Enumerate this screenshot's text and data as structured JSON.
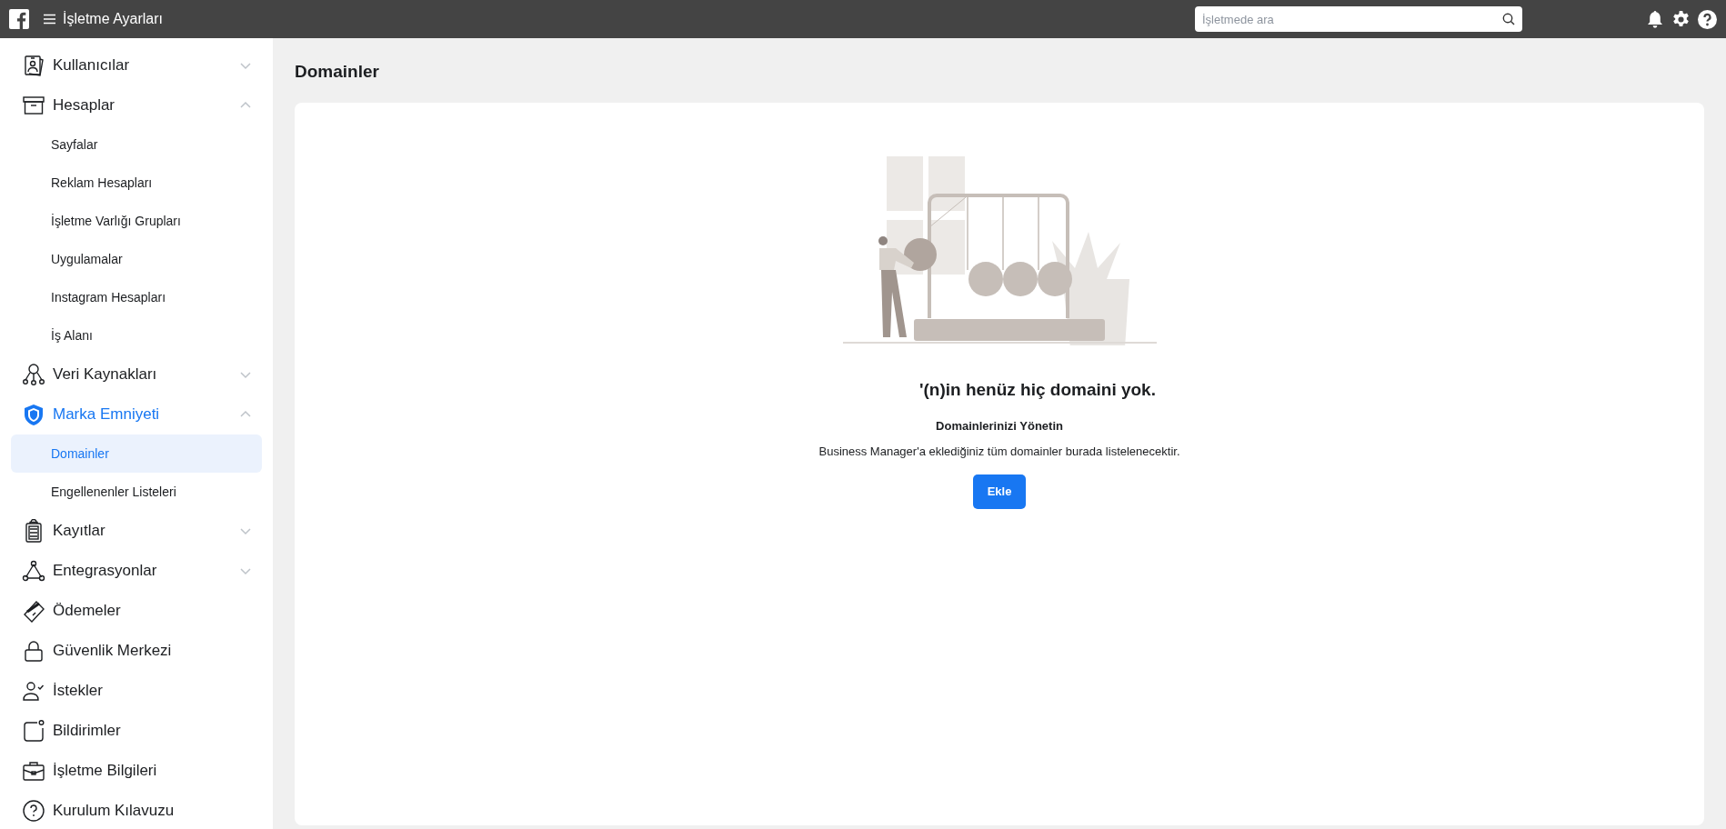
{
  "topbar": {
    "title": "İşletme Ayarları",
    "search": {
      "placeholder": "İşletmede ara"
    }
  },
  "sidebar": {
    "items": [
      {
        "kind": "group",
        "label": "Kullanıcılar",
        "expanded": false
      },
      {
        "kind": "group",
        "label": "Hesaplar",
        "expanded": true,
        "children": [
          {
            "label": "Sayfalar",
            "selected": false
          },
          {
            "label": "Reklam Hesapları",
            "selected": false
          },
          {
            "label": "İşletme Varlığı Grupları",
            "selected": false
          },
          {
            "label": "Uygulamalar",
            "selected": false
          },
          {
            "label": "Instagram Hesapları",
            "selected": false
          },
          {
            "label": "İş Alanı",
            "selected": false
          }
        ]
      },
      {
        "kind": "group",
        "label": "Veri Kaynakları",
        "expanded": false
      },
      {
        "kind": "group",
        "label": "Marka Emniyeti",
        "expanded": true,
        "children": [
          {
            "label": "Domainler",
            "selected": true
          },
          {
            "label": "Engellenenler Listeleri",
            "selected": false
          }
        ]
      },
      {
        "kind": "group",
        "label": "Kayıtlar",
        "expanded": false
      },
      {
        "kind": "group",
        "label": "Entegrasyonlar",
        "expanded": false
      },
      {
        "kind": "link",
        "label": "Ödemeler"
      },
      {
        "kind": "link",
        "label": "Güvenlik Merkezi"
      },
      {
        "kind": "link",
        "label": "İstekler"
      },
      {
        "kind": "link",
        "label": "Bildirimler"
      },
      {
        "kind": "link",
        "label": "İşletme Bilgileri"
      },
      {
        "kind": "link",
        "label": "Kurulum Kılavuzu"
      }
    ]
  },
  "main": {
    "title": "Domainler",
    "empty_state": {
      "heading": "'(n)in henüz hiç domaini yok.",
      "subheading": "Domainlerinizi Yönetin",
      "description": "Business Manager'a eklediğiniz tüm domainler burada listelenecektir.",
      "button": "Ekle"
    }
  }
}
